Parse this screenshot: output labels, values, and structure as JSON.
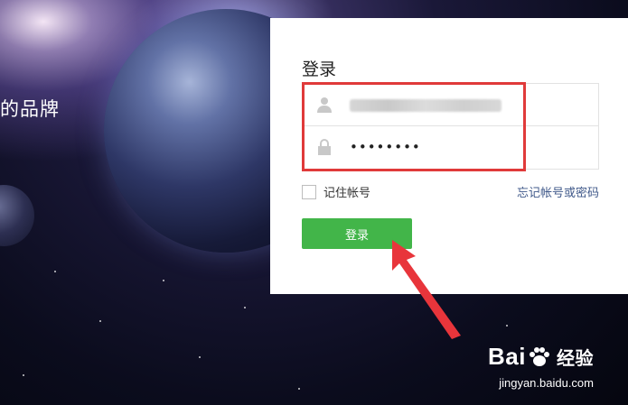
{
  "background": {
    "brand_text": "的品牌"
  },
  "login": {
    "title": "登录",
    "username_value": "",
    "password_value": "••••••••",
    "remember_label": "记住帐号",
    "forgot_label": "忘记帐号或密码",
    "submit_label": "登录",
    "accent_color": "#42b549",
    "highlight_color": "#e03a3a"
  },
  "watermark": {
    "brand_left": "Bai",
    "brand_right": "经验",
    "url": "jingyan.baidu.com"
  }
}
